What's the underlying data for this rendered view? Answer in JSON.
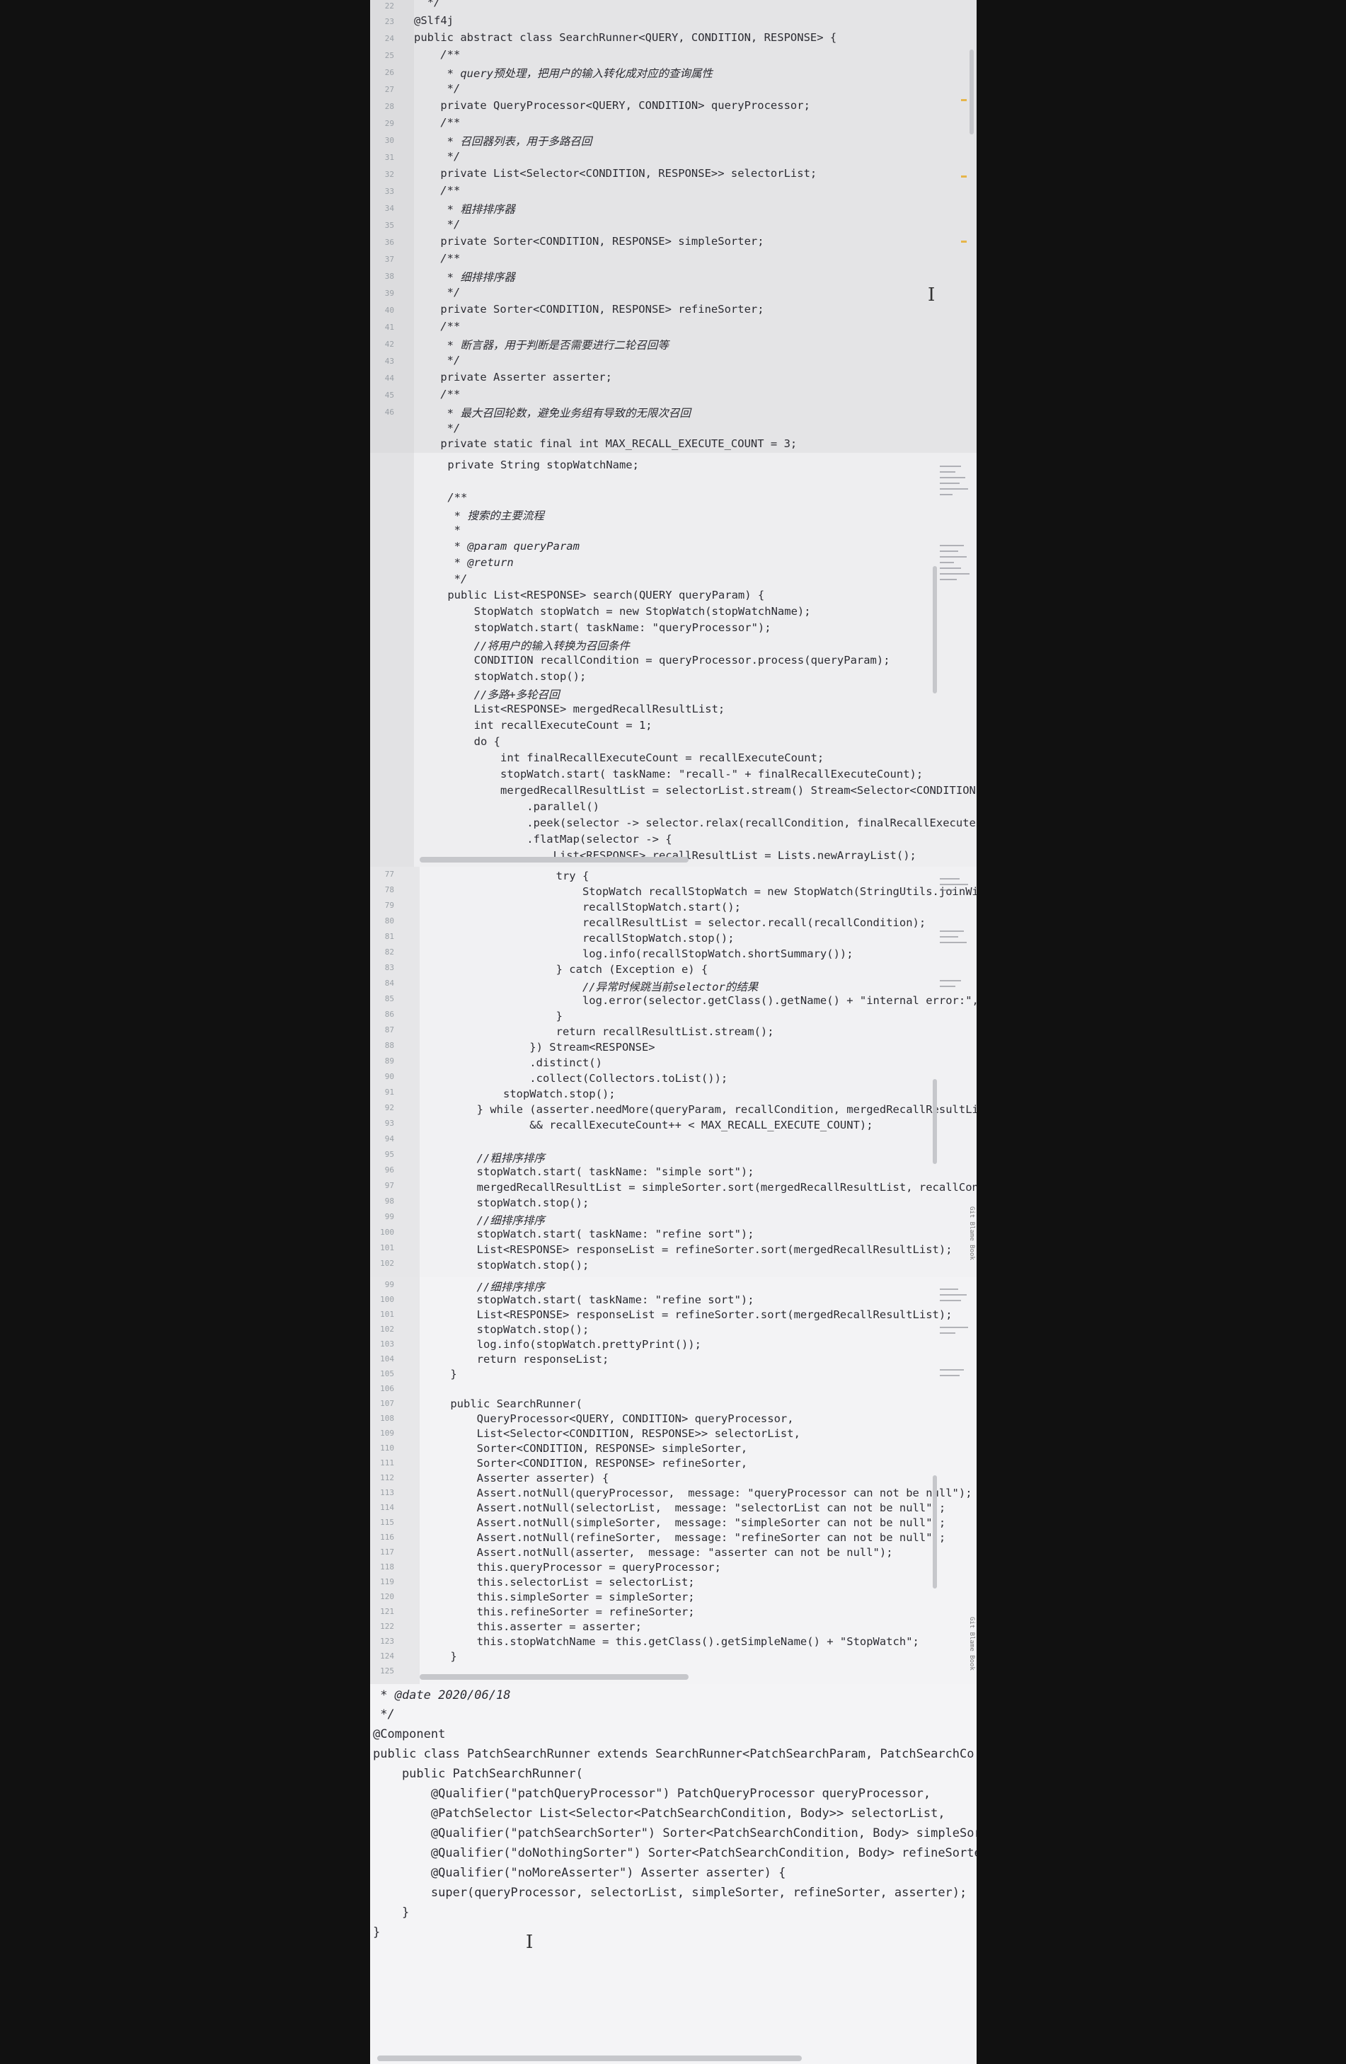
{
  "panel1": {
    "line_numbers": [
      "22",
      "23",
      "24",
      "25",
      "26",
      "27",
      "28",
      "29",
      "30",
      "31",
      "32",
      "33",
      "34",
      "35",
      "36",
      "37",
      "38",
      "39",
      "40",
      "41",
      "42",
      "43",
      "44",
      "45",
      "46"
    ],
    "lines": [
      "  */",
      "@Slf4j",
      "public abstract class SearchRunner<QUERY, CONDITION, RESPONSE> {",
      "    /**",
      "     * query预处理，把用户的输入转化成对应的查询属性",
      "     */",
      "    private QueryProcessor<QUERY, CONDITION> queryProcessor;",
      "    /**",
      "     * 召回器列表，用于多路召回",
      "     */",
      "    private List<Selector<CONDITION, RESPONSE>> selectorList;",
      "    /**",
      "     * 粗排排序器",
      "     */",
      "    private Sorter<CONDITION, RESPONSE> simpleSorter;",
      "    /**",
      "     * 细排排序器",
      "     */",
      "    private Sorter<CONDITION, RESPONSE> refineSorter;",
      "    /**",
      "     * 断言器，用于判断是否需要进行二轮召回等",
      "     */",
      "    private Asserter asserter;",
      "    /**",
      "     * 最大召回轮数，避免业务组有导致的无限次召回",
      "     */",
      "    private static final int MAX_RECALL_EXECUTE_COUNT = 3;"
    ]
  },
  "panel2": {
    "lines": [
      "    private String stopWatchName;",
      "",
      "    /**",
      "     * 搜索的主要流程",
      "     *",
      "     * @param queryParam",
      "     * @return",
      "     */",
      "    public List<RESPONSE> search(QUERY queryParam) {",
      "        StopWatch stopWatch = new StopWatch(stopWatchName);",
      "        stopWatch.start( taskName: \"queryProcessor\");",
      "        //将用户的输入转换为召回条件",
      "        CONDITION recallCondition = queryProcessor.process(queryParam);",
      "        stopWatch.stop();",
      "        //多路+多轮召回",
      "        List<RESPONSE> mergedRecallResultList;",
      "        int recallExecuteCount = 1;",
      "        do {",
      "            int finalRecallExecuteCount = recallExecuteCount;",
      "            stopWatch.start( taskName: \"recall-\" + finalRecallExecuteCount);",
      "            mergedRecallResultList = selectorList.stream() Stream<Selector<CONDITION, RESPO",
      "                .parallel()",
      "                .peek(selector -> selector.relax(recallCondition, finalRecallExecuteCo",
      "                .flatMap(selector -> {",
      "                    List<RESPONSE> recallResultList = Lists.newArrayList();"
    ]
  },
  "panel3": {
    "line_numbers": [
      "77",
      "78",
      "79",
      "80",
      "81",
      "82",
      "83",
      "84",
      "85",
      "86",
      "87",
      "88",
      "89",
      "90",
      "91",
      "92",
      "93",
      "94",
      "95",
      "96",
      "97",
      "98",
      "99",
      "100",
      "101",
      "102"
    ],
    "lines": [
      "                    try {",
      "                        StopWatch recallStopWatch = new StopWatch(StringUtils.joinWith",
      "                        recallStopWatch.start();",
      "                        recallResultList = selector.recall(recallCondition);",
      "                        recallStopWatch.stop();",
      "                        log.info(recallStopWatch.shortSummary());",
      "                    } catch (Exception e) {",
      "                        //异常时候跳当前selector的结果",
      "                        log.error(selector.getClass().getName() + \"internal error:\", e",
      "                    }",
      "                    return recallResultList.stream();",
      "                }) Stream<RESPONSE>",
      "                .distinct()",
      "                .collect(Collectors.toList());",
      "            stopWatch.stop();",
      "        } while (asserter.needMore(queryParam, recallCondition, mergedRecallResultList",
      "                && recallExecuteCount++ < MAX_RECALL_EXECUTE_COUNT);",
      "",
      "        //粗排序排序",
      "        stopWatch.start( taskName: \"simple sort\");",
      "        mergedRecallResultList = simpleSorter.sort(mergedRecallResultList, recallCondi",
      "        stopWatch.stop();",
      "        //细排序排序",
      "        stopWatch.start( taskName: \"refine sort\");",
      "        List<RESPONSE> responseList = refineSorter.sort(mergedRecallResultList);",
      "        stopWatch.stop();"
    ],
    "side_label": "Git Blame Book"
  },
  "panel4": {
    "line_numbers": [
      "99",
      "100",
      "101",
      "102",
      "103",
      "104",
      "105",
      "106",
      "107",
      "108",
      "109",
      "110",
      "111",
      "112",
      "113",
      "114",
      "115",
      "116",
      "117",
      "118",
      "119",
      "120",
      "121",
      "122",
      "123",
      "124",
      "125"
    ],
    "lines": [
      "        //细排序排序",
      "        stopWatch.start( taskName: \"refine sort\");",
      "        List<RESPONSE> responseList = refineSorter.sort(mergedRecallResultList);",
      "        stopWatch.stop();",
      "        log.info(stopWatch.prettyPrint());",
      "        return responseList;",
      "    }",
      "",
      "    public SearchRunner(",
      "        QueryProcessor<QUERY, CONDITION> queryProcessor,",
      "        List<Selector<CONDITION, RESPONSE>> selectorList,",
      "        Sorter<CONDITION, RESPONSE> simpleSorter,",
      "        Sorter<CONDITION, RESPONSE> refineSorter,",
      "        Asserter asserter) {",
      "        Assert.notNull(queryProcessor,  message: \"queryProcessor can not be null\");",
      "        Assert.notNull(selectorList,  message: \"selectorList can not be null\");",
      "        Assert.notNull(simpleSorter,  message: \"simpleSorter can not be null\");",
      "        Assert.notNull(refineSorter,  message: \"refineSorter can not be null\");",
      "        Assert.notNull(asserter,  message: \"asserter can not be null\");",
      "        this.queryProcessor = queryProcessor;",
      "        this.selectorList = selectorList;",
      "        this.simpleSorter = simpleSorter;",
      "        this.refineSorter = refineSorter;",
      "        this.asserter = asserter;",
      "        this.stopWatchName = this.getClass().getSimpleName() + \"StopWatch\";",
      "    }",
      ""
    ],
    "side_label": "Git Blame Book"
  },
  "panel5": {
    "lines": [
      " * @date 2020/06/18",
      " */",
      "@Component",
      "public class PatchSearchRunner extends SearchRunner<PatchSearchParam, PatchSearchCo",
      "    public PatchSearchRunner(",
      "        @Qualifier(\"patchQueryProcessor\") PatchQueryProcessor queryProcessor,",
      "        @PatchSelector List<Selector<PatchSearchCondition, Body>> selectorList,",
      "        @Qualifier(\"patchSearchSorter\") Sorter<PatchSearchCondition, Body> simpleSor",
      "        @Qualifier(\"doNothingSorter\") Sorter<PatchSearchCondition, Body> refineSorte",
      "        @Qualifier(\"noMoreAsserter\") Asserter asserter) {",
      "        super(queryProcessor, selectorList, simpleSorter, refineSorter, asserter);",
      "    }",
      "}"
    ]
  },
  "colors": {
    "keyword": "#0a2d8a",
    "comment": "#8c8c8c",
    "string": "#0b6b17",
    "field": "#7a1f8b",
    "highlight": "#f2d98a",
    "annotation": "#7e7a12",
    "background": "#111111"
  }
}
